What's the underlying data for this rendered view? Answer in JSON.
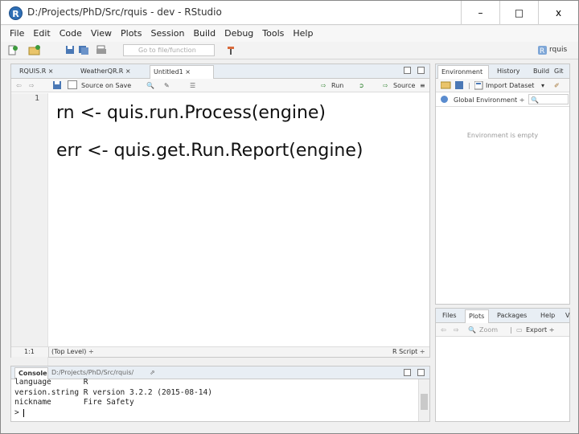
{
  "window": {
    "title": "D:/Projects/PhD/Src/rquis - dev - RStudio",
    "app_icon": "R",
    "minimize_symbol": "–",
    "maximize_symbol": "□",
    "close_symbol": "x"
  },
  "menu": [
    "File",
    "Edit",
    "Code",
    "View",
    "Plots",
    "Session",
    "Build",
    "Debug",
    "Tools",
    "Help"
  ],
  "toolbar": {
    "goto_placeholder": "Go to file/function",
    "project_label": "rquis"
  },
  "editor": {
    "tabs": [
      {
        "label": "RQUIS.R"
      },
      {
        "label": "WeatherQR.R"
      },
      {
        "label": "Untitled1"
      }
    ],
    "source_on_save_label": "Source on Save",
    "run_label": "Run",
    "source_label": "Source",
    "line_numbers": [
      "1"
    ],
    "code_lines": [
      "rn <- quis.run.Process(engine)",
      "err <- quis.get.Run.Report(engine)"
    ],
    "status": {
      "position": "1:1",
      "scope": "(Top Level) ÷",
      "language": "R Script ÷"
    }
  },
  "environment_pane": {
    "tabs": [
      "Environment",
      "History",
      "Build",
      "Git"
    ],
    "import_label": "Import Dataset",
    "scope_label": "Global Environment ÷",
    "empty_text": "Environment is empty"
  },
  "files_pane": {
    "tabs": [
      "Files",
      "Plots",
      "Packages",
      "Help",
      "V"
    ],
    "zoom_label": "Zoom",
    "export_label": "Export ÷"
  },
  "console": {
    "title": "Console",
    "path": "D:/Projects/PhD/Src/rquis/",
    "lines": [
      "language       R",
      "version.string R version 3.2.2 (2015-08-14)",
      "nickname       Fire Safety"
    ],
    "prompt": ">"
  },
  "colors": {
    "accent": "#2f6fb5",
    "tab_strip": "#e8eef4"
  }
}
